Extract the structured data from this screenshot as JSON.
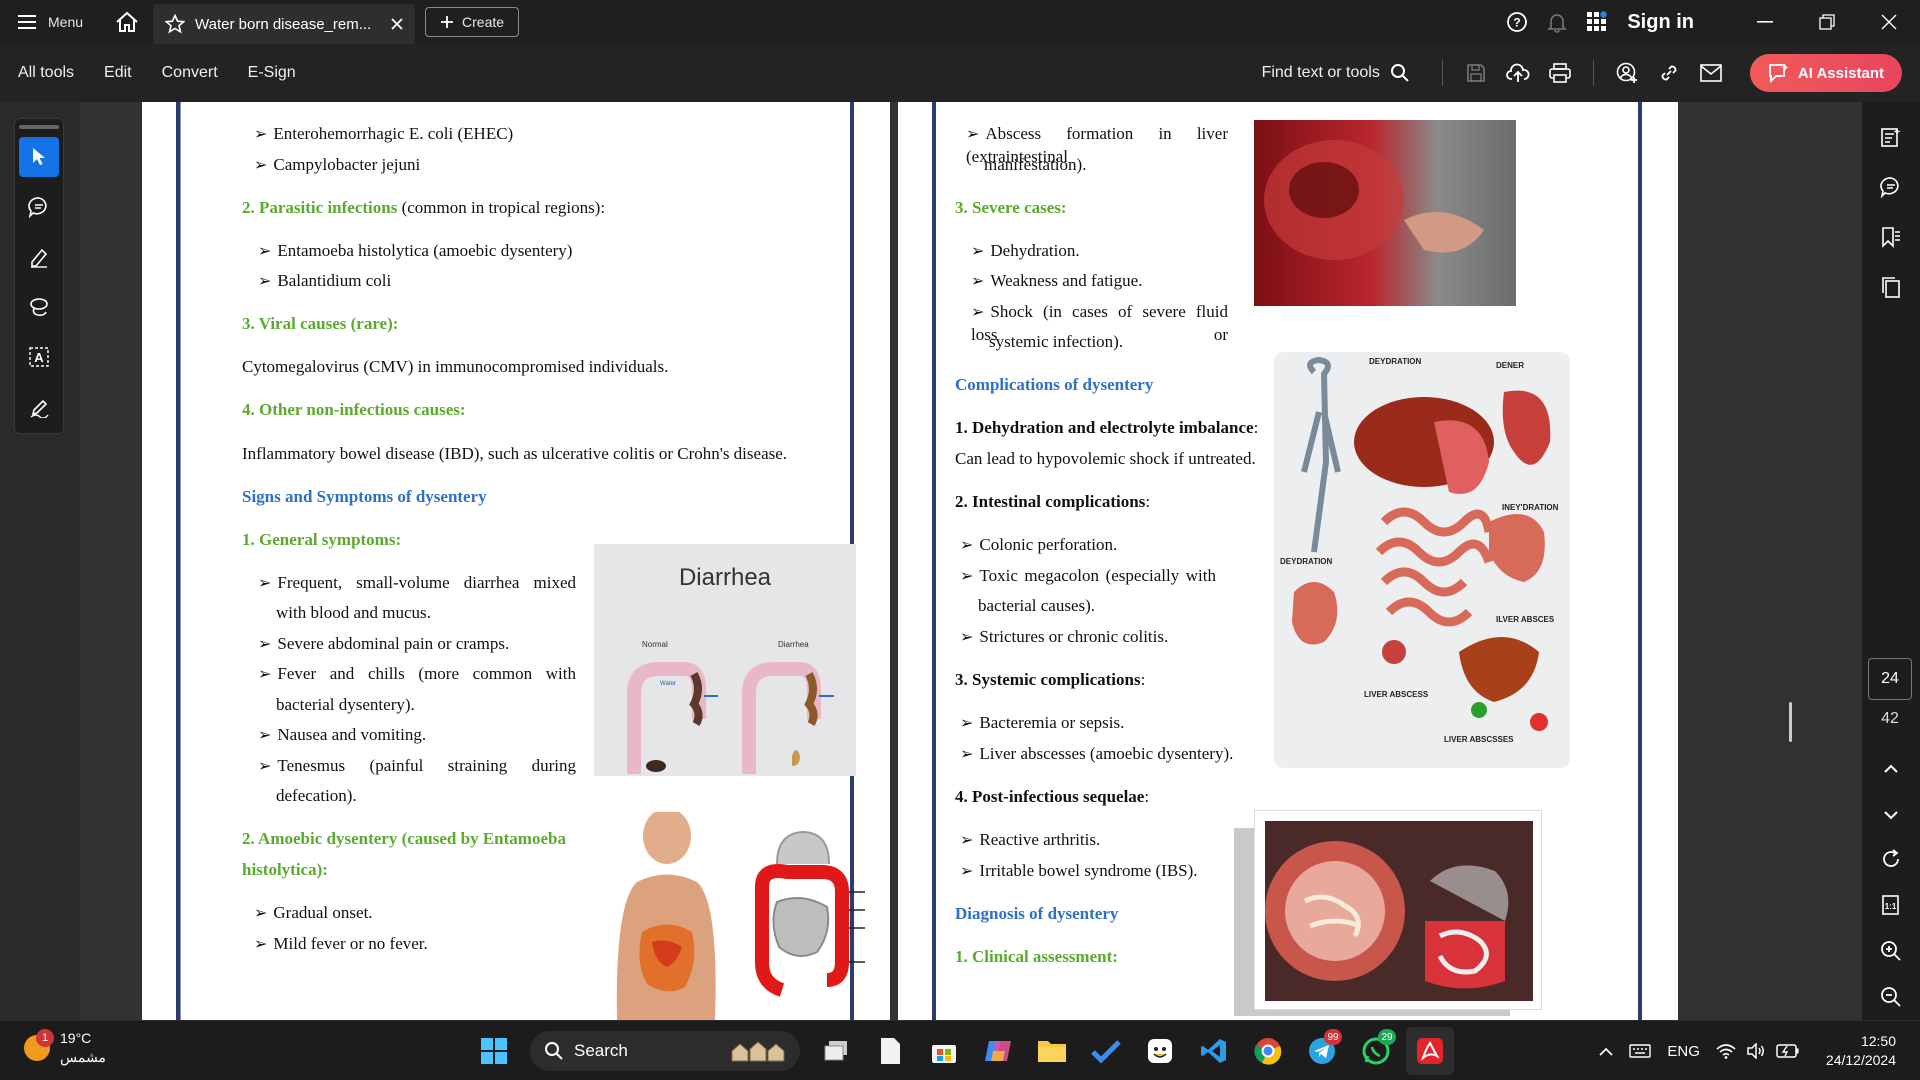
{
  "titlebar": {
    "menu_label": "Menu",
    "tab_title": "Water born disease_rem...",
    "create_label": "Create",
    "signin_label": "Sign in"
  },
  "toolbar": {
    "menus": [
      "All tools",
      "Edit",
      "Convert",
      "E-Sign"
    ],
    "find_label": "Find text or tools",
    "ai_label": "AI Assistant"
  },
  "navigation": {
    "current_page": "24",
    "total_pages": "42"
  },
  "page_left": {
    "lines": [
      {
        "text": "Enterohemorrhagic E. coli (EHEC)",
        "style": "bullet"
      },
      {
        "text": "Campylobacter jejuni",
        "style": "bullet"
      },
      {
        "heading": "2. Parasitic infections",
        "rest": " (common in tropical regions):"
      },
      {
        "text": "Entamoeba histolytica (amoebic dysentery)",
        "style": "bullet"
      },
      {
        "text": "Balantidium coli",
        "style": "bullet"
      },
      {
        "text": "3. Viral causes (rare):",
        "style": "green"
      },
      {
        "text": "Cytomegalovirus (CMV) in immunocompromised individuals.",
        "style": "plain"
      },
      {
        "text": "4. Other non-infectious causes:",
        "style": "green"
      },
      {
        "text": "Inflammatory bowel disease (IBD), such as ulcerative colitis or Crohn's disease.",
        "style": "plain"
      },
      {
        "text": "Signs and Symptoms of dysentery",
        "style": "blue"
      },
      {
        "text": "1. General symptoms:",
        "style": "green"
      },
      {
        "text": "Frequent, small-volume diarrhea mixed",
        "style": "bullet-just"
      },
      {
        "text": "with blood and mucus.",
        "style": "indent"
      },
      {
        "text": "Severe abdominal pain or cramps.",
        "style": "bullet"
      },
      {
        "text": "Fever and chills (more common with",
        "style": "bullet-just"
      },
      {
        "text": "bacterial dysentery).",
        "style": "indent"
      },
      {
        "text": "Nausea and vomiting.",
        "style": "bullet"
      },
      {
        "text": "Tenesmus (painful straining during",
        "style": "bullet-just"
      },
      {
        "text": "defecation).",
        "style": "indent"
      },
      {
        "text": "2. Amoebic dysentery (caused by Entamoeba",
        "style": "green"
      },
      {
        "text": "histolytica):",
        "style": "green"
      },
      {
        "text": "Gradual onset.",
        "style": "bullet"
      },
      {
        "text": "Mild fever or no fever.",
        "style": "bullet"
      }
    ],
    "diarrhea_figure": {
      "title": "Diarrhea",
      "normal_label": "Normal",
      "diarrhea_label": "Diarrhea",
      "water_label": "Water"
    }
  },
  "page_right": {
    "lines": [
      {
        "text": "Abscess formation in liver (extraintestinal",
        "style": "bullet-just"
      },
      {
        "text": "manifestation).",
        "style": "indent"
      },
      {
        "text": "3. Severe cases:",
        "style": "green"
      },
      {
        "text": "Dehydration.",
        "style": "bullet"
      },
      {
        "text": "Weakness and fatigue.",
        "style": "bullet"
      },
      {
        "text": "Shock (in cases of severe fluid loss or",
        "style": "bullet-just"
      },
      {
        "text": "systemic infection).",
        "style": "indent"
      },
      {
        "text": "Complications of dysentery",
        "style": "blue"
      },
      {
        "heading": "1. Dehydration and electrolyte imbalance",
        "rest": ":"
      },
      {
        "text": "Can lead to hypovolemic shock if untreated.",
        "style": "plain"
      },
      {
        "heading": "2. Intestinal complications",
        "rest": ":"
      },
      {
        "text": "Colonic perforation.",
        "style": "bullet"
      },
      {
        "text": "Toxic megacolon (especially with",
        "style": "bullet-just"
      },
      {
        "text": "bacterial causes).",
        "style": "indent"
      },
      {
        "text": "Strictures or chronic colitis.",
        "style": "bullet"
      },
      {
        "heading": "3. Systemic complications",
        "rest": ":"
      },
      {
        "text": "Bacteremia or sepsis.",
        "style": "bullet"
      },
      {
        "text": "Liver abscesses (amoebic dysentery).",
        "style": "bullet"
      },
      {
        "heading": "4. Post-infectious sequelae",
        "rest": ":"
      },
      {
        "text": "Reactive arthritis.",
        "style": "bullet"
      },
      {
        "text": "Irritable bowel syndrome (IBS).",
        "style": "bullet"
      },
      {
        "text": "Diagnosis of dysentery",
        "style": "blue"
      },
      {
        "text": "1. Clinical assessment:",
        "style": "green"
      }
    ],
    "organs_figure": {
      "labels": [
        "DEYDRATION",
        "DENER",
        "INEY'DRATION",
        "DEYDRATION",
        "ILVER ABSCES",
        "LIVER ABSCESS",
        "LIVER ABSCSSES"
      ]
    }
  },
  "taskbar": {
    "weather_badge": "1",
    "temperature": "19°C",
    "weather_condition": "مشمس",
    "search_label": "Search",
    "telegram_badge": "99",
    "whatsapp_badge": "29",
    "language": "ENG",
    "time": "12:50",
    "date": "24/12/2024"
  }
}
